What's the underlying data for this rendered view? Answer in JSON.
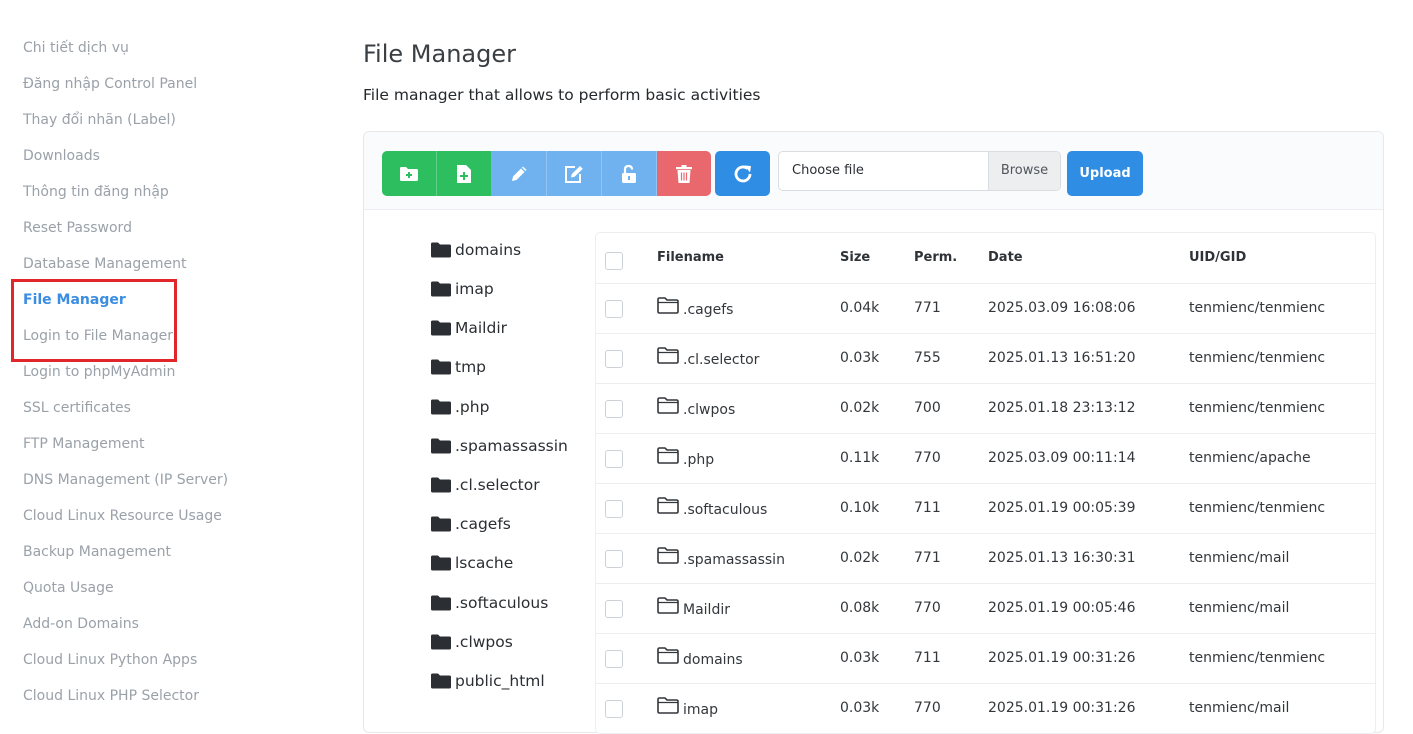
{
  "sidebar": {
    "items": [
      {
        "label": "Chi tiết dịch vụ",
        "active": false
      },
      {
        "label": "Đăng nhập Control Panel",
        "active": false
      },
      {
        "label": "Thay đổi nhãn (Label)",
        "active": false
      },
      {
        "label": "Downloads",
        "active": false
      },
      {
        "label": "Thông tin đăng nhập",
        "active": false
      },
      {
        "label": "Reset Password",
        "active": false
      },
      {
        "label": "Database Management",
        "active": false
      },
      {
        "label": "File Manager",
        "active": true
      },
      {
        "label": "Login to File Manager",
        "active": false
      },
      {
        "label": "Login to phpMyAdmin",
        "active": false
      },
      {
        "label": "SSL certificates",
        "active": false
      },
      {
        "label": "FTP Management",
        "active": false
      },
      {
        "label": "DNS Management (IP Server)",
        "active": false
      },
      {
        "label": "Cloud Linux Resource Usage",
        "active": false
      },
      {
        "label": "Backup Management",
        "active": false
      },
      {
        "label": "Quota Usage",
        "active": false
      },
      {
        "label": "Add-on Domains",
        "active": false
      },
      {
        "label": "Cloud Linux Python Apps",
        "active": false
      },
      {
        "label": "Cloud Linux PHP Selector",
        "active": false
      }
    ]
  },
  "main": {
    "title": "File Manager",
    "subtitle": "File manager that allows to perform basic activities"
  },
  "toolbar": {
    "buttons": [
      {
        "icon": "new-folder-icon",
        "color": "#2dbe60"
      },
      {
        "icon": "new-file-icon",
        "color": "#2dbe60"
      },
      {
        "icon": "pencil-icon",
        "color": "#6fb2ef"
      },
      {
        "icon": "edit-icon",
        "color": "#6fb2ef"
      },
      {
        "icon": "unlock-icon",
        "color": "#6fb2ef"
      },
      {
        "icon": "trash-icon",
        "color": "#e8686e"
      }
    ],
    "refresh_icon": "refresh-icon",
    "file_placeholder": "Choose file",
    "browse_label": "Browse",
    "upload_label": "Upload"
  },
  "tree": [
    "domains",
    "imap",
    "Maildir",
    "tmp",
    ".php",
    ".spamassassin",
    ".cl.selector",
    ".cagefs",
    "lscache",
    ".softaculous",
    ".clwpos",
    "public_html"
  ],
  "table": {
    "headers": {
      "filename": "Filename",
      "size": "Size",
      "perm": "Perm.",
      "date": "Date",
      "uid": "UID/GID"
    },
    "rows": [
      {
        "name": ".cagefs",
        "size": "0.04k",
        "perm": "771",
        "date": "2025.03.09 16:08:06",
        "uid": "tenmienc/tenmienc"
      },
      {
        "name": ".cl.selector",
        "size": "0.03k",
        "perm": "755",
        "date": "2025.01.13 16:51:20",
        "uid": "tenmienc/tenmienc"
      },
      {
        "name": ".clwpos",
        "size": "0.02k",
        "perm": "700",
        "date": "2025.01.18 23:13:12",
        "uid": "tenmienc/tenmienc"
      },
      {
        "name": ".php",
        "size": "0.11k",
        "perm": "770",
        "date": "2025.03.09 00:11:14",
        "uid": "tenmienc/apache"
      },
      {
        "name": ".softaculous",
        "size": "0.10k",
        "perm": "711",
        "date": "2025.01.19 00:05:39",
        "uid": "tenmienc/tenmienc"
      },
      {
        "name": ".spamassassin",
        "size": "0.02k",
        "perm": "771",
        "date": "2025.01.13 16:30:31",
        "uid": "tenmienc/mail"
      },
      {
        "name": "Maildir",
        "size": "0.08k",
        "perm": "770",
        "date": "2025.01.19 00:05:46",
        "uid": "tenmienc/mail"
      },
      {
        "name": "domains",
        "size": "0.03k",
        "perm": "711",
        "date": "2025.01.19 00:31:26",
        "uid": "tenmienc/tenmienc"
      },
      {
        "name": "imap",
        "size": "0.03k",
        "perm": "770",
        "date": "2025.01.19 00:31:26",
        "uid": "tenmienc/mail"
      }
    ]
  }
}
